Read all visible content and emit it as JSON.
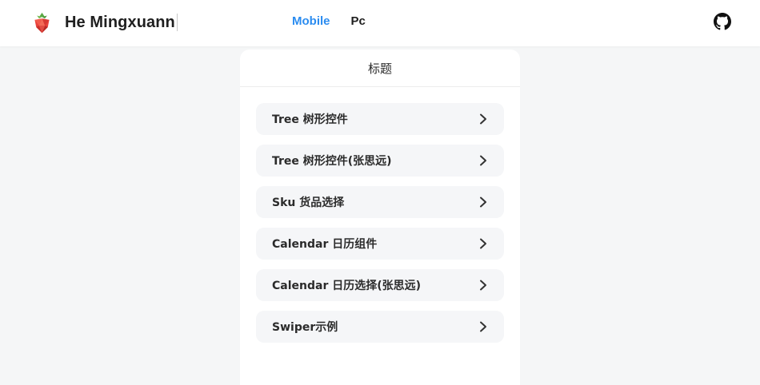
{
  "header": {
    "brand_name": "He Mingxuann",
    "logo_icon": "strawberry-logo-icon",
    "nav": [
      {
        "label": "Mobile",
        "active": true
      },
      {
        "label": "Pc",
        "active": false
      }
    ],
    "github_icon": "github-icon"
  },
  "colors": {
    "accent": "#2b8cf0",
    "page_bg": "#f5f6f7",
    "item_bg": "#f5f6f8"
  },
  "panel": {
    "title": "标题",
    "items": [
      {
        "label": "Tree 树形控件"
      },
      {
        "label": "Tree 树形控件(张思远)"
      },
      {
        "label": "Sku 货品选择"
      },
      {
        "label": "Calendar 日历组件"
      },
      {
        "label": "Calendar 日历选择(张思远)"
      },
      {
        "label": "Swiper示例"
      }
    ]
  }
}
